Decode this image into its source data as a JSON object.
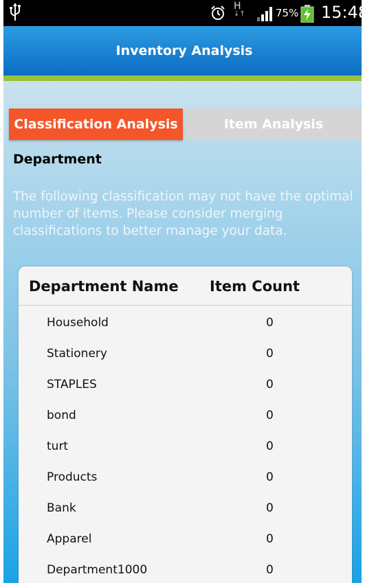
{
  "status_bar": {
    "battery_percent": "75%",
    "time": "15:48",
    "network_type": "H",
    "icons": [
      "usb-icon",
      "alarm-icon",
      "hspa-data-icon",
      "signal-icon",
      "battery-charging-icon"
    ]
  },
  "header": {
    "title": "Inventory Analysis",
    "color": "#1a7fd0",
    "accent_line_color": "#9bc23d"
  },
  "tabs": [
    {
      "label": "Classification Analysis",
      "active": true,
      "color": "#f45629"
    },
    {
      "label": "Item Analysis",
      "active": false,
      "color": "#d5d5d5"
    }
  ],
  "main": {
    "section_heading": "Department",
    "note": "The following classification may not have the optimal number of items. Please consider merging classifications to better manage your data.",
    "table": {
      "columns": [
        "Department Name",
        "Item Count"
      ],
      "rows": [
        {
          "name": "Household",
          "count": "0"
        },
        {
          "name": "Stationery",
          "count": "0"
        },
        {
          "name": "STAPLES",
          "count": "0"
        },
        {
          "name": "bond",
          "count": "0"
        },
        {
          "name": "turt",
          "count": "0"
        },
        {
          "name": "Products",
          "count": "0"
        },
        {
          "name": "Bank",
          "count": "0"
        },
        {
          "name": "Apparel",
          "count": "0"
        },
        {
          "name": "Department1000",
          "count": "0"
        }
      ]
    }
  }
}
